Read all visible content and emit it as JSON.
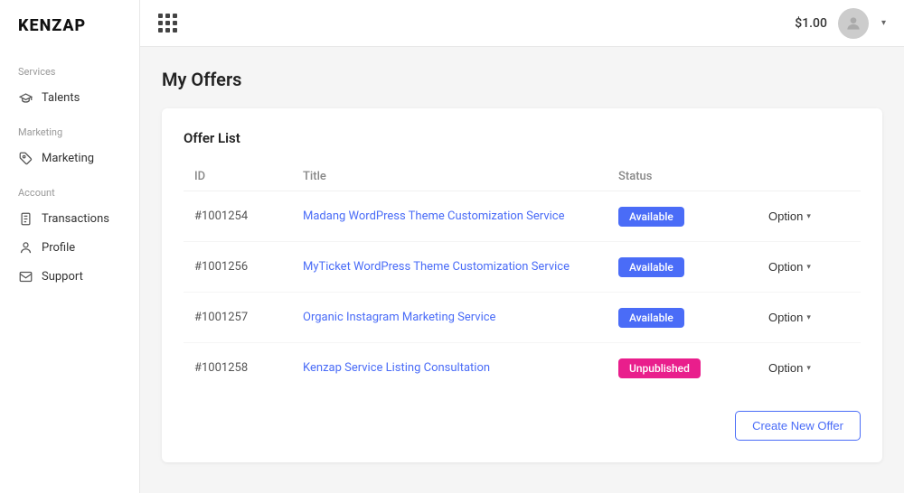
{
  "brand": "KENZAP",
  "topbar": {
    "balance": "$1.00",
    "chevron": "▾"
  },
  "sidebar": {
    "sections": [
      {
        "label": "Services",
        "items": [
          {
            "id": "talents",
            "label": "Talents",
            "icon": "graduation"
          }
        ]
      },
      {
        "label": "Marketing",
        "items": [
          {
            "id": "marketing",
            "label": "Marketing",
            "icon": "tag"
          }
        ]
      },
      {
        "label": "Account",
        "items": [
          {
            "id": "transactions",
            "label": "Transactions",
            "icon": "doc"
          },
          {
            "id": "profile",
            "label": "Profile",
            "icon": "person"
          },
          {
            "id": "support",
            "label": "Support",
            "icon": "envelope"
          }
        ]
      }
    ]
  },
  "page": {
    "title": "My Offers",
    "card_title": "Offer List"
  },
  "table": {
    "headers": [
      "ID",
      "Title",
      "Status",
      ""
    ],
    "rows": [
      {
        "id": "#1001254",
        "title": "Madang WordPress Theme Customization Service",
        "status": "Available",
        "status_type": "available",
        "option_label": "Option"
      },
      {
        "id": "#1001256",
        "title": "MyTicket WordPress Theme Customization Service",
        "status": "Available",
        "status_type": "available",
        "option_label": "Option"
      },
      {
        "id": "#1001257",
        "title": "Organic Instagram Marketing Service",
        "status": "Available",
        "status_type": "available",
        "option_label": "Option"
      },
      {
        "id": "#1001258",
        "title": "Kenzap Service Listing Consultation",
        "status": "Unpublished",
        "status_type": "unpublished",
        "option_label": "Option"
      }
    ]
  },
  "create_button_label": "Create New Offer"
}
